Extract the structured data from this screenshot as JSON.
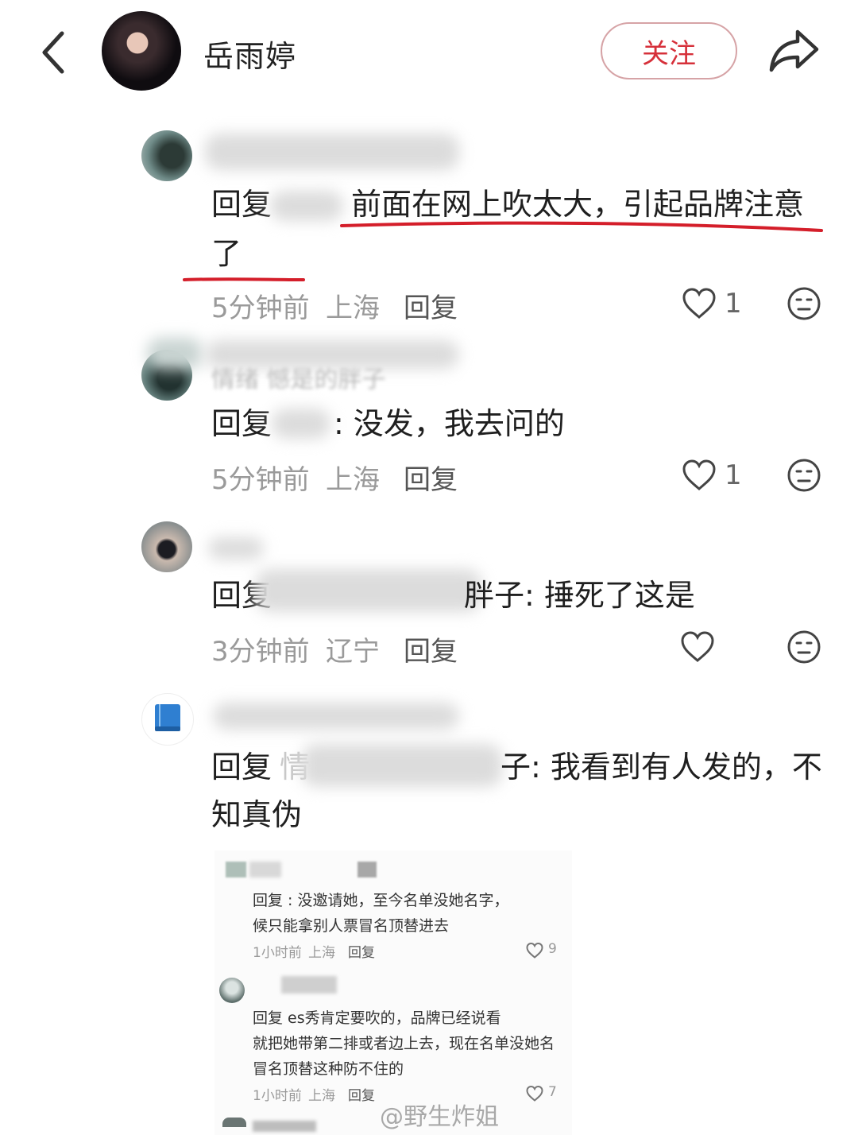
{
  "header": {
    "user_name": "岳雨婷",
    "follow_label": "关注"
  },
  "comments": [
    {
      "reply_prefix": "回复",
      "text": "前面在网上吹太大，引起品牌注意",
      "text_cont": "了",
      "time": "5分钟前",
      "location": "上海",
      "reply_label": "回复",
      "likes": "1"
    },
    {
      "user_partial": "情绪  憾是的胖子",
      "reply_prefix": "回复",
      "text": ": 没发，我去问的",
      "time": "5分钟前",
      "location": "上海",
      "reply_label": "回复",
      "likes": "1"
    },
    {
      "reply_prefix": "回复",
      "text_tail": "胖子: 捶死了这是",
      "time": "3分钟前",
      "location": "辽宁",
      "reply_label": "回复"
    },
    {
      "reply_prefix": "回复",
      "reply_partial": "情",
      "text_tail": "子: 我看到有人发的，不",
      "text_cont": "知真伪"
    }
  ],
  "embedded": {
    "items": [
      {
        "line1": "回复        : 没邀请她，至今名单没她名字，",
        "line2": "候只能拿别人票冒名顶替进去",
        "time": "1小时前",
        "location": "上海",
        "reply_label": "回复",
        "likes": "9"
      },
      {
        "line1": "回复            es秀肯定要吹的，品牌已经说看",
        "line2": "就把她带第二排或者边上去，现在名单没她名",
        "line3": "冒名顶替这种防不住的",
        "time": "1小时前",
        "location": "上海",
        "reply_label": "回复",
        "likes": "7"
      }
    ]
  },
  "watermark": "@野生炸姐",
  "colors": {
    "accent": "#d6303a",
    "underline": "#d41e2a",
    "meta": "#9a9a9a"
  }
}
